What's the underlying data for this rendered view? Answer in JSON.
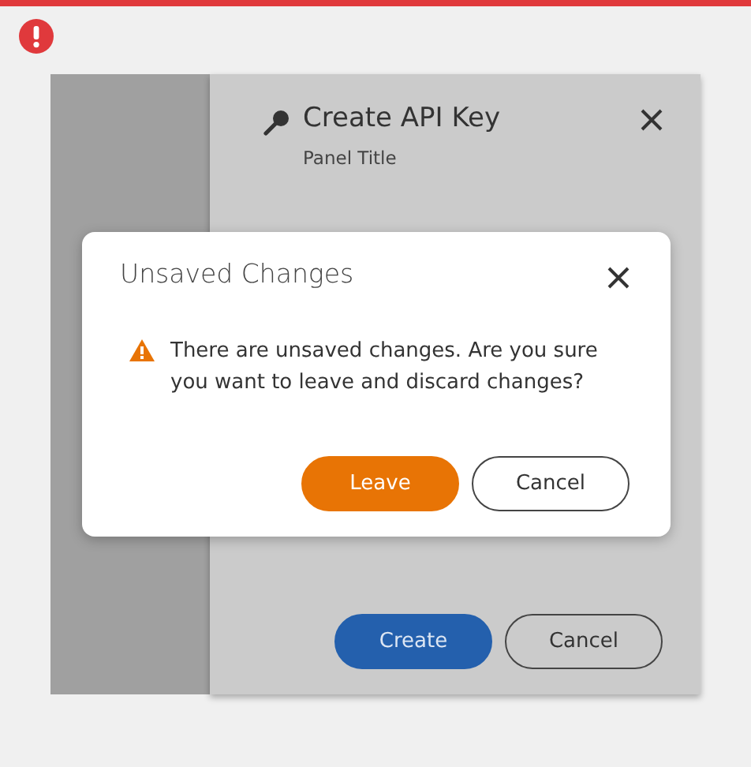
{
  "panel": {
    "title": "Create API Key",
    "subtitle": "Panel Title",
    "buttons": [
      {
        "label": "Create",
        "kind": "primary"
      },
      {
        "label": "Cancel",
        "kind": "secondary"
      }
    ]
  },
  "dialog": {
    "title": "Unsaved Changes",
    "message": "There are unsaved changes. Are you sure you want to leave and discard changes?",
    "buttons": [
      {
        "label": "Leave",
        "kind": "primary"
      },
      {
        "label": "Cancel",
        "kind": "secondary"
      }
    ]
  }
}
